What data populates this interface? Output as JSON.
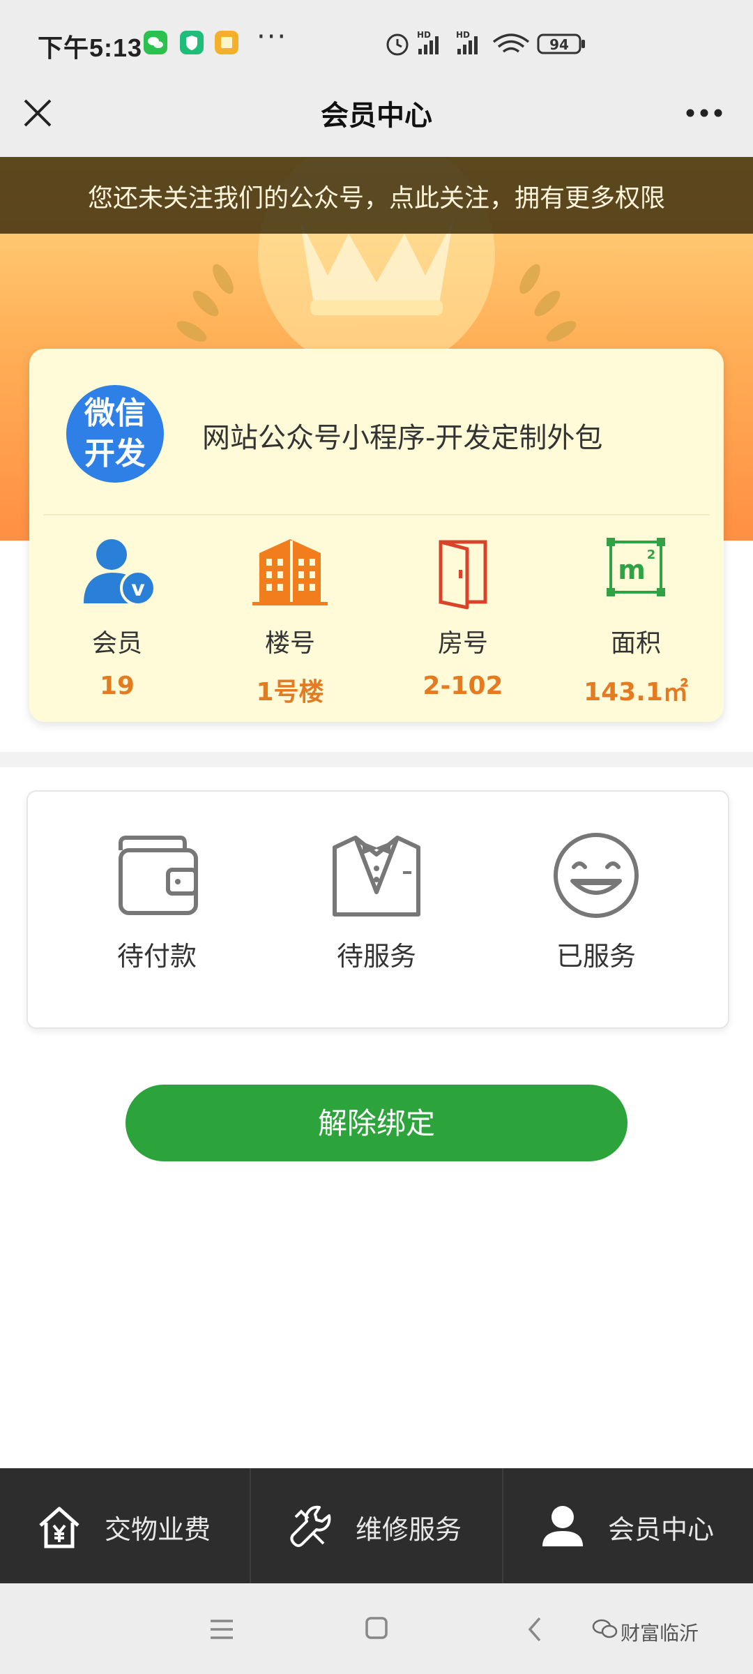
{
  "status": {
    "time": "下午5:13",
    "battery": "94"
  },
  "nav": {
    "title": "会员中心"
  },
  "banner": {
    "follow_text": "您还未关注我们的公众号，点此关注，拥有更多权限"
  },
  "card": {
    "logo_line1": "微信",
    "logo_line2": "开发",
    "name": "网站公众号小程序-开发定制外包",
    "stats": [
      {
        "label": "会员",
        "value": "19",
        "icon": "member-v-icon"
      },
      {
        "label": "楼号",
        "value": "1号楼",
        "icon": "building-icon"
      },
      {
        "label": "房号",
        "value": "2-102",
        "icon": "door-icon"
      },
      {
        "label": "面积",
        "value": "143.1㎡",
        "icon": "area-m2-icon"
      }
    ]
  },
  "orders": [
    {
      "label": "待付款",
      "icon": "wallet-icon"
    },
    {
      "label": "待服务",
      "icon": "butler-icon"
    },
    {
      "label": "已服务",
      "icon": "smiley-icon"
    }
  ],
  "unbind_button": "解除绑定",
  "tabs": [
    {
      "label": "交物业费",
      "icon": "house-yen-icon"
    },
    {
      "label": "维修服务",
      "icon": "wrench-icon"
    },
    {
      "label": "会员中心",
      "icon": "user-icon"
    }
  ],
  "watermark": "财富临沂",
  "colors": {
    "accent_green": "#2da33c",
    "stat_orange": "#e47b21",
    "card_bg": "#fffad7",
    "tabbar_bg": "#2d2d2d"
  }
}
